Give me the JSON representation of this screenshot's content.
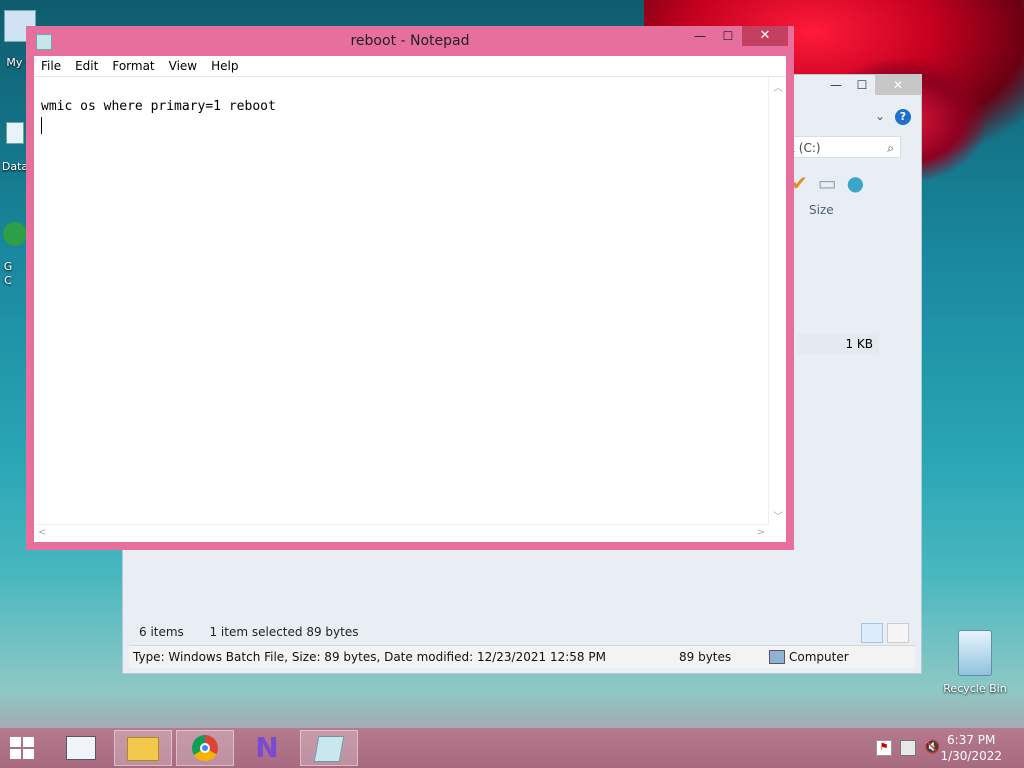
{
  "desktop": {
    "icons": [
      {
        "label": "My C"
      },
      {
        "label": "Data"
      },
      {
        "label": "G C"
      },
      {
        "label": "Recycle Bin"
      }
    ]
  },
  "explorer": {
    "search_placeholder": "k (C:)",
    "column_size": "Size",
    "file_size": "1 KB",
    "items_count": "6 items",
    "selection": "1 item selected  89 bytes",
    "details": "Type: Windows Batch File, Size: 89 bytes, Date modified: 12/23/2021 12:58 PM",
    "details_size": "89 bytes",
    "location": "Computer",
    "help": "?"
  },
  "notepad": {
    "title": "reboot - Notepad",
    "menu": [
      "File",
      "Edit",
      "Format",
      "View",
      "Help"
    ],
    "content": "wmic os where primary=1 reboot"
  },
  "taskbar": {
    "time": "6:37 PM",
    "date": "1/30/2022"
  }
}
